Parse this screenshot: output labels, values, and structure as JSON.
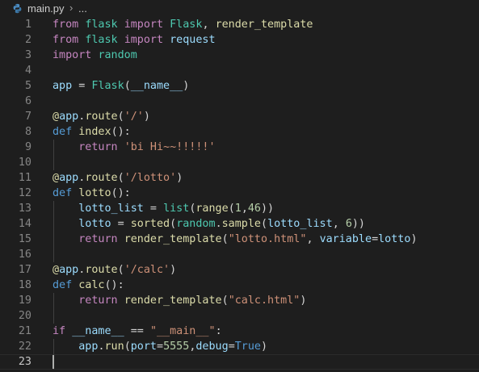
{
  "breadcrumb": {
    "file": "main.py",
    "separator": "›",
    "more": "..."
  },
  "editor": {
    "lines": [
      {
        "n": "1",
        "tokens": [
          [
            "from ",
            "kw"
          ],
          [
            "flask ",
            "cls"
          ],
          [
            "import ",
            "kw"
          ],
          [
            "Flask",
            "cls"
          ],
          [
            ", ",
            "pl"
          ],
          [
            "render_template",
            "fn"
          ]
        ]
      },
      {
        "n": "2",
        "tokens": [
          [
            "from ",
            "kw"
          ],
          [
            "flask ",
            "cls"
          ],
          [
            "import ",
            "kw"
          ],
          [
            "request",
            "var"
          ]
        ]
      },
      {
        "n": "3",
        "tokens": [
          [
            "import ",
            "kw"
          ],
          [
            "random",
            "cls"
          ]
        ]
      },
      {
        "n": "4",
        "tokens": []
      },
      {
        "n": "5",
        "tokens": [
          [
            "app",
            "var"
          ],
          [
            " = ",
            "pl"
          ],
          [
            "Flask",
            "cls"
          ],
          [
            "(",
            "pl"
          ],
          [
            "__name__",
            "var"
          ],
          [
            ")",
            "pl"
          ]
        ]
      },
      {
        "n": "6",
        "tokens": []
      },
      {
        "n": "7",
        "tokens": [
          [
            "@",
            "fn"
          ],
          [
            "app",
            "var"
          ],
          [
            ".",
            "pl"
          ],
          [
            "route",
            "fn"
          ],
          [
            "(",
            "pl"
          ],
          [
            "'/'",
            "str"
          ],
          [
            ")",
            "pl"
          ]
        ]
      },
      {
        "n": "8",
        "tokens": [
          [
            "def ",
            "def"
          ],
          [
            "index",
            "fn"
          ],
          [
            "():",
            "pl"
          ]
        ]
      },
      {
        "n": "9",
        "tokens": [
          [
            "    ",
            "pl"
          ],
          [
            "return ",
            "kw"
          ],
          [
            "'bi Hi~~!!!!!'",
            "str"
          ]
        ]
      },
      {
        "n": "10",
        "tokens": []
      },
      {
        "n": "11",
        "tokens": [
          [
            "@",
            "fn"
          ],
          [
            "app",
            "var"
          ],
          [
            ".",
            "pl"
          ],
          [
            "route",
            "fn"
          ],
          [
            "(",
            "pl"
          ],
          [
            "'/lotto'",
            "str"
          ],
          [
            ")",
            "pl"
          ]
        ]
      },
      {
        "n": "12",
        "tokens": [
          [
            "def ",
            "def"
          ],
          [
            "lotto",
            "fn"
          ],
          [
            "():",
            "pl"
          ]
        ]
      },
      {
        "n": "13",
        "tokens": [
          [
            "    ",
            "pl"
          ],
          [
            "lotto_list",
            "var"
          ],
          [
            " = ",
            "pl"
          ],
          [
            "list",
            "cls"
          ],
          [
            "(",
            "pl"
          ],
          [
            "range",
            "fn"
          ],
          [
            "(",
            "pl"
          ],
          [
            "1",
            "num"
          ],
          [
            ",",
            "pl"
          ],
          [
            "46",
            "num"
          ],
          [
            "))",
            "pl"
          ]
        ]
      },
      {
        "n": "14",
        "tokens": [
          [
            "    ",
            "pl"
          ],
          [
            "lotto",
            "var"
          ],
          [
            " = ",
            "pl"
          ],
          [
            "sorted",
            "fn"
          ],
          [
            "(",
            "pl"
          ],
          [
            "random",
            "cls"
          ],
          [
            ".",
            "pl"
          ],
          [
            "sample",
            "fn"
          ],
          [
            "(",
            "pl"
          ],
          [
            "lotto_list",
            "var"
          ],
          [
            ", ",
            "pl"
          ],
          [
            "6",
            "num"
          ],
          [
            "))",
            "pl"
          ]
        ]
      },
      {
        "n": "15",
        "tokens": [
          [
            "    ",
            "pl"
          ],
          [
            "return ",
            "kw"
          ],
          [
            "render_template",
            "fn"
          ],
          [
            "(",
            "pl"
          ],
          [
            "\"lotto.html\"",
            "str"
          ],
          [
            ", ",
            "pl"
          ],
          [
            "variable",
            "var"
          ],
          [
            "=",
            "pl"
          ],
          [
            "lotto",
            "var"
          ],
          [
            ")",
            "pl"
          ]
        ]
      },
      {
        "n": "16",
        "tokens": []
      },
      {
        "n": "17",
        "tokens": [
          [
            "@",
            "fn"
          ],
          [
            "app",
            "var"
          ],
          [
            ".",
            "pl"
          ],
          [
            "route",
            "fn"
          ],
          [
            "(",
            "pl"
          ],
          [
            "'/calc'",
            "str"
          ],
          [
            ")",
            "pl"
          ]
        ]
      },
      {
        "n": "18",
        "tokens": [
          [
            "def ",
            "def"
          ],
          [
            "calc",
            "fn"
          ],
          [
            "():",
            "pl"
          ]
        ]
      },
      {
        "n": "19",
        "tokens": [
          [
            "    ",
            "pl"
          ],
          [
            "return ",
            "kw"
          ],
          [
            "render_template",
            "fn"
          ],
          [
            "(",
            "pl"
          ],
          [
            "\"calc.html\"",
            "str"
          ],
          [
            ")",
            "pl"
          ]
        ]
      },
      {
        "n": "20",
        "tokens": []
      },
      {
        "n": "21",
        "tokens": [
          [
            "if ",
            "kw"
          ],
          [
            "__name__",
            "var"
          ],
          [
            " == ",
            "pl"
          ],
          [
            "\"__main__\"",
            "str"
          ],
          [
            ":",
            "pl"
          ]
        ]
      },
      {
        "n": "22",
        "tokens": [
          [
            "    ",
            "pl"
          ],
          [
            "app",
            "var"
          ],
          [
            ".",
            "pl"
          ],
          [
            "run",
            "fn"
          ],
          [
            "(",
            "pl"
          ],
          [
            "port",
            "var"
          ],
          [
            "=",
            "pl"
          ],
          [
            "5555",
            "num"
          ],
          [
            ",",
            "pl"
          ],
          [
            "debug",
            "var"
          ],
          [
            "=",
            "pl"
          ],
          [
            "True",
            "def"
          ],
          [
            ")",
            "pl"
          ]
        ]
      },
      {
        "n": "23",
        "tokens": []
      }
    ],
    "current_line": "23"
  },
  "colors": {
    "background": "#1e1e1e",
    "keyword": "#c586c0",
    "storage": "#569cd6",
    "function": "#dcdcaa",
    "class": "#4ec9b0",
    "variable": "#9cdcfe",
    "string": "#ce9178",
    "number": "#b5cea8"
  },
  "icons": {
    "file_icon": "python-file-icon"
  }
}
